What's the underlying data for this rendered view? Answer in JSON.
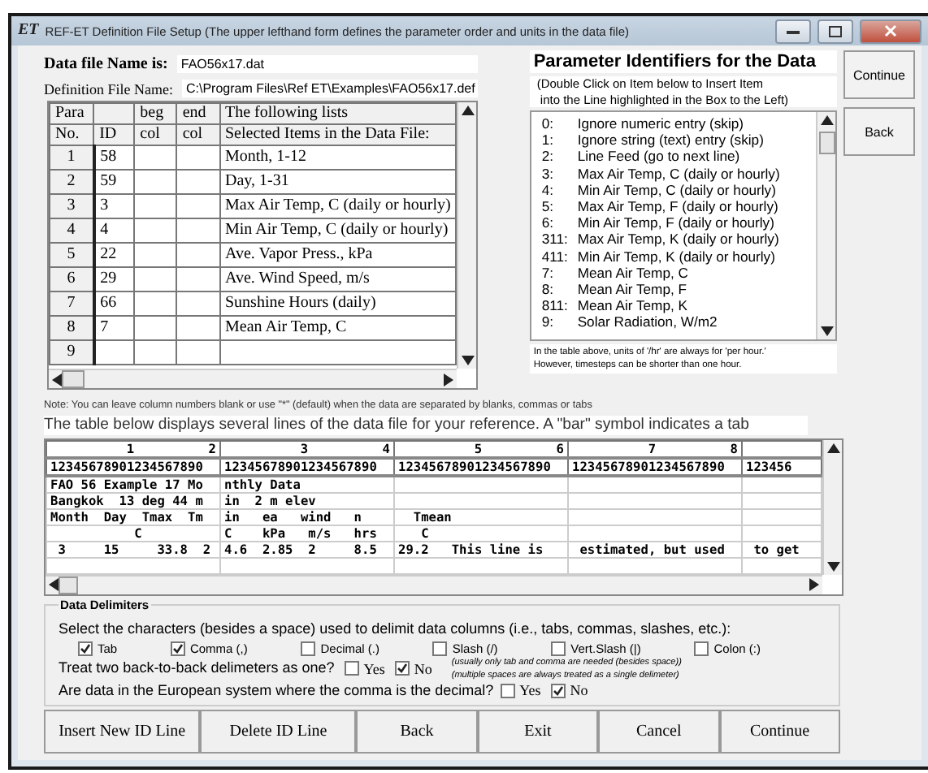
{
  "window": {
    "icon": "ET",
    "title": "REF-ET Definition File Setup   (The upper lefthand form defines the parameter order and units in the data file)"
  },
  "data_file": {
    "label": "Data file Name is:",
    "value": "FAO56x17.dat"
  },
  "definition_file": {
    "label": "Definition File Name:",
    "value": "C:\\Program Files\\Ref ET\\Examples\\FAO56x17.def"
  },
  "param_table": {
    "columns": [
      {
        "top": "Para",
        "bottom": "No."
      },
      {
        "bottom": "ID"
      },
      {
        "top": "beg",
        "bottom": "col"
      },
      {
        "top": "end",
        "bottom": "col"
      },
      {
        "top": "The following lists",
        "bottom": "Selected Items in the Data File:"
      }
    ],
    "rows": [
      {
        "no": "1",
        "id": "58",
        "item": "Month, 1-12"
      },
      {
        "no": "2",
        "id": "59",
        "item": "Day, 1-31"
      },
      {
        "no": "3",
        "id": "3",
        "item": "Max Air Temp, C (daily or hourly)"
      },
      {
        "no": "4",
        "id": "4",
        "item": "Min Air Temp, C (daily or hourly)"
      },
      {
        "no": "5",
        "id": "22",
        "item": "Ave. Vapor Press., kPa"
      },
      {
        "no": "6",
        "id": "29",
        "item": "Ave. Wind Speed, m/s"
      },
      {
        "no": "7",
        "id": "66",
        "item": "Sunshine Hours (daily)"
      },
      {
        "no": "8",
        "id": "7",
        "item": "Mean Air Temp, C"
      },
      {
        "no": "9"
      }
    ]
  },
  "identifiers": {
    "title": "Parameter Identifiers for the Data",
    "hint": "(Double Click on Item below to Insert Item\n into the Line highlighted in the Box to the Left)",
    "items": [
      {
        "code": "0:",
        "label": "Ignore numeric entry (skip)"
      },
      {
        "code": "1:",
        "label": "Ignore string (text) entry (skip)"
      },
      {
        "code": "2:",
        "label": "Line Feed (go to next line)"
      },
      {
        "code": "3:",
        "label": "Max Air Temp, C (daily or hourly)"
      },
      {
        "code": "4:",
        "label": "Min Air Temp, C (daily or hourly)"
      },
      {
        "code": "5:",
        "label": "Max Air Temp, F (daily or hourly)"
      },
      {
        "code": "6:",
        "label": "Min Air Temp, F (daily or hourly)"
      },
      {
        "code": "311:",
        "label": "Max Air Temp, K (daily or hourly)"
      },
      {
        "code": "411:",
        "label": "Min Air Temp, K (daily or hourly)"
      },
      {
        "code": "7:",
        "label": "Mean Air Temp, C"
      },
      {
        "code": "8:",
        "label": "Mean Air Temp, F"
      },
      {
        "code": "811:",
        "label": "Mean Air Temp, K"
      },
      {
        "code": "9:",
        "label": "Solar Radiation, W/m2"
      }
    ],
    "units_note": "In the table above, units of '/hr' are always for 'per hour.'\nHowever, timesteps can be shorter than one hour."
  },
  "side_buttons": [
    "Continue",
    "Back"
  ],
  "note": "Note: You can leave column numbers blank or use \"*\" (default) when the data are separated by blanks, commas or tabs",
  "data_caption": "The table below displays several lines of the data file for your reference. A \"bar\" symbol indicates a tab",
  "data_table": {
    "ruler_1": [
      [
        "1",
        "2"
      ],
      [
        "3",
        "4"
      ],
      [
        "5",
        "6"
      ],
      [
        "7",
        "8"
      ]
    ],
    "ruler_2": [
      "12345678901234567890",
      "12345678901234567890",
      "12345678901234567890",
      "12345678901234567890",
      "123456"
    ],
    "rows": [
      [
        "FAO 56 Example 17 Mo",
        "nthly Data"
      ],
      [
        "Bangkok  13 deg 44 m",
        "in  2 m elev"
      ],
      [
        "Month  Day  Tmax  Tm",
        "in   ea   wind   n",
        "  Tmean"
      ],
      [
        "           C",
        "C    kPa   m/s   hrs",
        "   C"
      ],
      [
        " 3     15     33.8  2",
        "4.6  2.85  2     8.5",
        "29.2   This line is",
        " estimated, but used",
        " to get"
      ]
    ]
  },
  "delimiters": {
    "title": "Data Delimiters",
    "prompt": "Select the characters (besides a space) used to delimit data columns (i.e., tabs, commas, slashes, etc.):",
    "options": [
      {
        "label": "Tab",
        "checked": true
      },
      {
        "label": "Comma (,)",
        "checked": true
      },
      {
        "label": "Decimal (.)",
        "checked": false
      },
      {
        "label": "Slash (/)",
        "checked": false
      },
      {
        "label": "Vert.Slash (|)",
        "checked": false
      },
      {
        "label": "Colon (:)",
        "checked": false
      }
    ],
    "back_to_back": {
      "question": "Treat two back-to-back delimeters as one?",
      "options": [
        {
          "label": "Yes",
          "checked": false
        },
        {
          "label": "No",
          "checked": true
        }
      ]
    },
    "hints": [
      "(usually only tab and comma are needed (besides space))",
      "(multiple spaces are always treated as a single delimeter)"
    ],
    "european": {
      "question": "Are data in the European system where the comma is the decimal?",
      "options": [
        {
          "label": "Yes",
          "checked": false
        },
        {
          "label": "No",
          "checked": true
        }
      ]
    }
  },
  "bottom_buttons": [
    "Insert New ID Line",
    "Delete ID Line",
    "Back",
    "Exit",
    "Cancel",
    "Continue"
  ]
}
